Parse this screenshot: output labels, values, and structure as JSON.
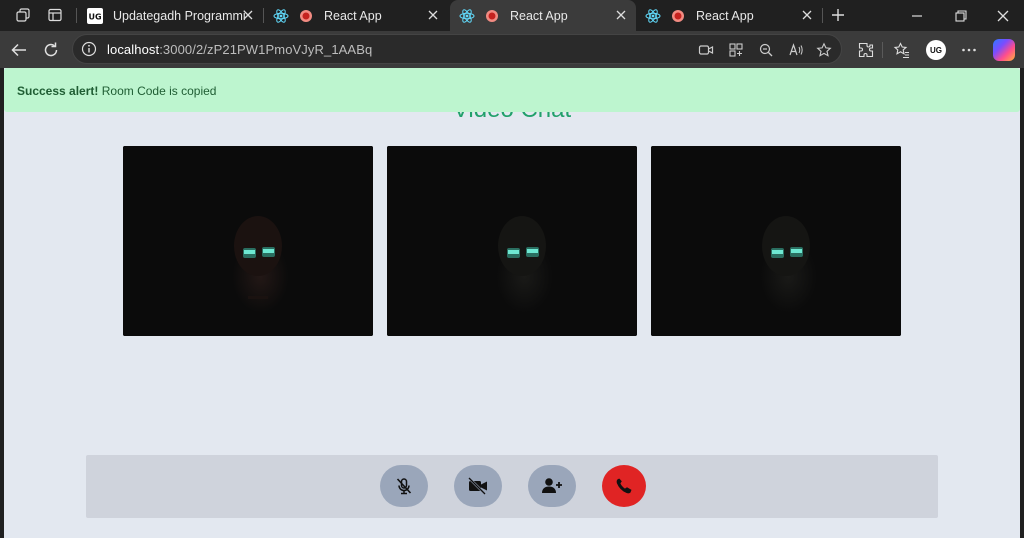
{
  "tabs": [
    {
      "title": "Updategadh Programming",
      "favicon": "updategadh-logo",
      "active": false
    },
    {
      "title": "React App",
      "favicon": "react-icon",
      "active": false
    },
    {
      "title": "React App",
      "favicon": "react-icon",
      "active": true
    },
    {
      "title": "React App",
      "favicon": "react-icon",
      "active": false
    }
  ],
  "address": {
    "host": "localhost",
    "path": ":3000/2/zP21PW1PmoVJyR_1AABq"
  },
  "profile": {
    "initials": "UG"
  },
  "alert": {
    "strong": "Success alert!",
    "message": " Room Code is copied"
  },
  "page": {
    "title": "Video Chat"
  },
  "videos": [
    {
      "label": "participant-video-1"
    },
    {
      "label": "participant-video-2"
    },
    {
      "label": "participant-video-3"
    }
  ],
  "controls": [
    {
      "name": "mute-microphone",
      "icon": "mic-off-icon"
    },
    {
      "name": "stop-camera",
      "icon": "video-off-icon"
    },
    {
      "name": "add-participant",
      "icon": "user-plus-icon"
    },
    {
      "name": "end-call",
      "icon": "phone-icon"
    }
  ],
  "colors": {
    "alert_bg": "#bdf5cf",
    "title": "#22a06b",
    "control": "#9aa6ba",
    "end_call": "#e02424",
    "page_bg": "#e3e8f0"
  }
}
